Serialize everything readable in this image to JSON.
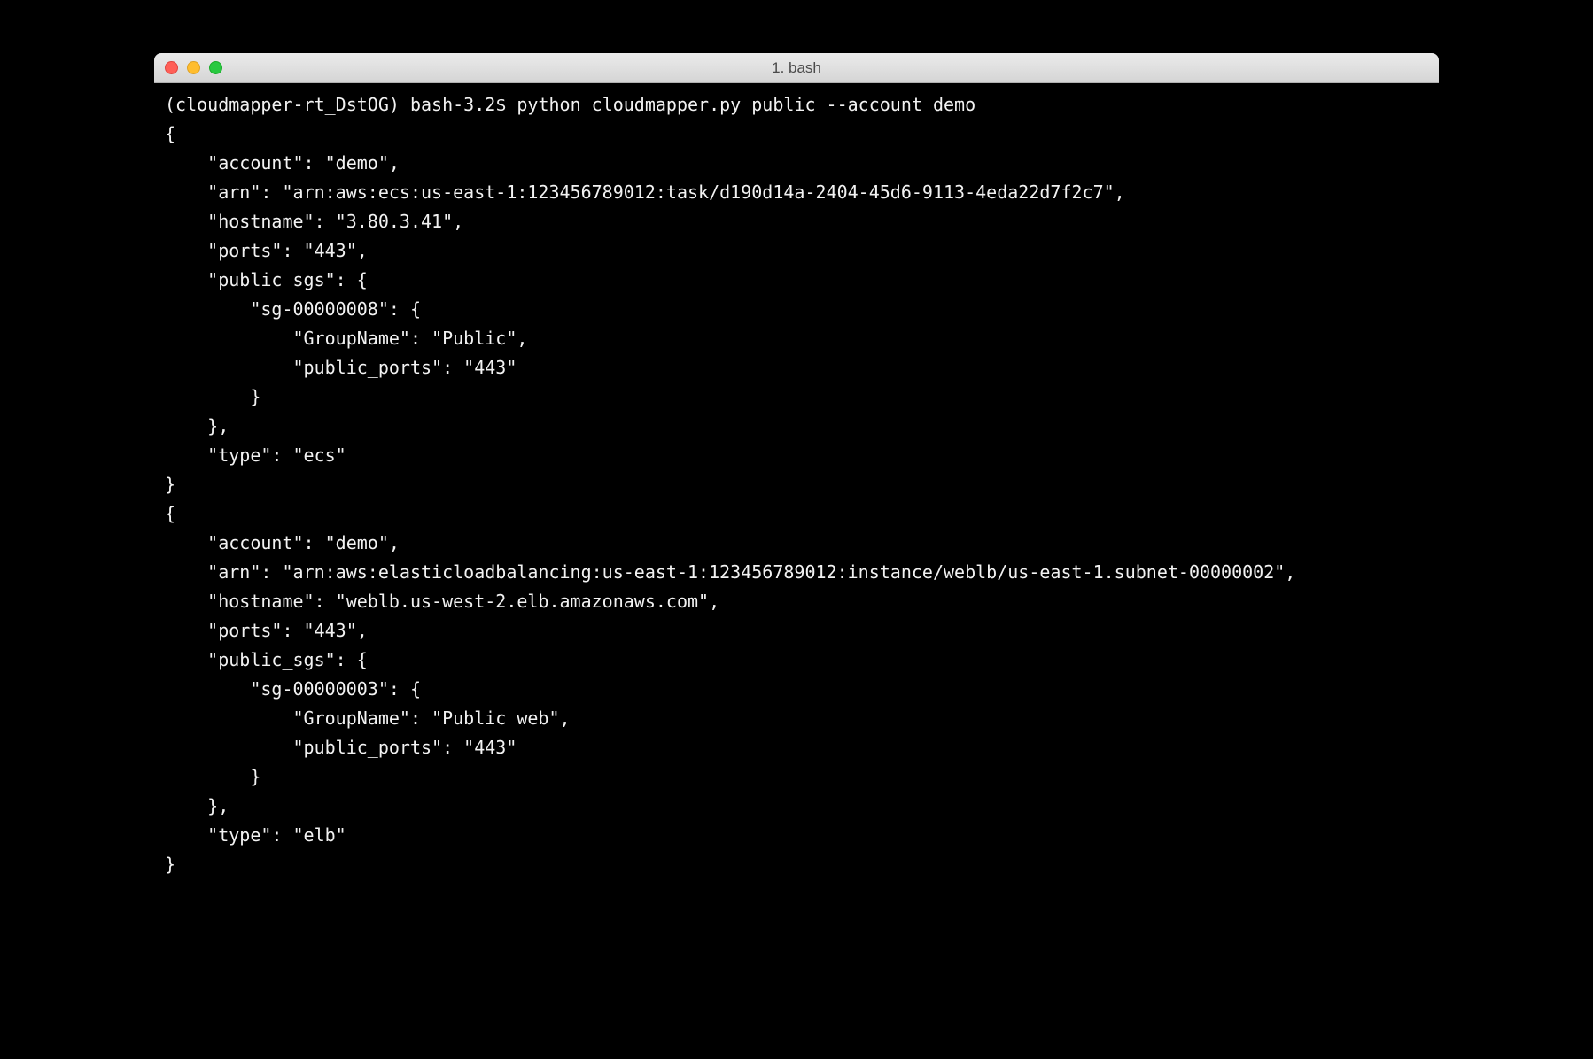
{
  "window": {
    "title": "1. bash"
  },
  "terminal": {
    "prompt": "(cloudmapper-rt_DstOG) bash-3.2$ ",
    "command": "python cloudmapper.py public --account demo",
    "output_lines": [
      "{",
      "    \"account\": \"demo\",",
      "    \"arn\": \"arn:aws:ecs:us-east-1:123456789012:task/d190d14a-2404-45d6-9113-4eda22d7f2c7\",",
      "    \"hostname\": \"3.80.3.41\",",
      "    \"ports\": \"443\",",
      "    \"public_sgs\": {",
      "        \"sg-00000008\": {",
      "            \"GroupName\": \"Public\",",
      "            \"public_ports\": \"443\"",
      "        }",
      "    },",
      "    \"type\": \"ecs\"",
      "}",
      "{",
      "    \"account\": \"demo\",",
      "    \"arn\": \"arn:aws:elasticloadbalancing:us-east-1:123456789012:instance/weblb/us-east-1.subnet-00000002\",",
      "    \"hostname\": \"weblb.us-west-2.elb.amazonaws.com\",",
      "    \"ports\": \"443\",",
      "    \"public_sgs\": {",
      "        \"sg-00000003\": {",
      "            \"GroupName\": \"Public web\",",
      "            \"public_ports\": \"443\"",
      "        }",
      "    },",
      "    \"type\": \"elb\"",
      "}"
    ]
  }
}
